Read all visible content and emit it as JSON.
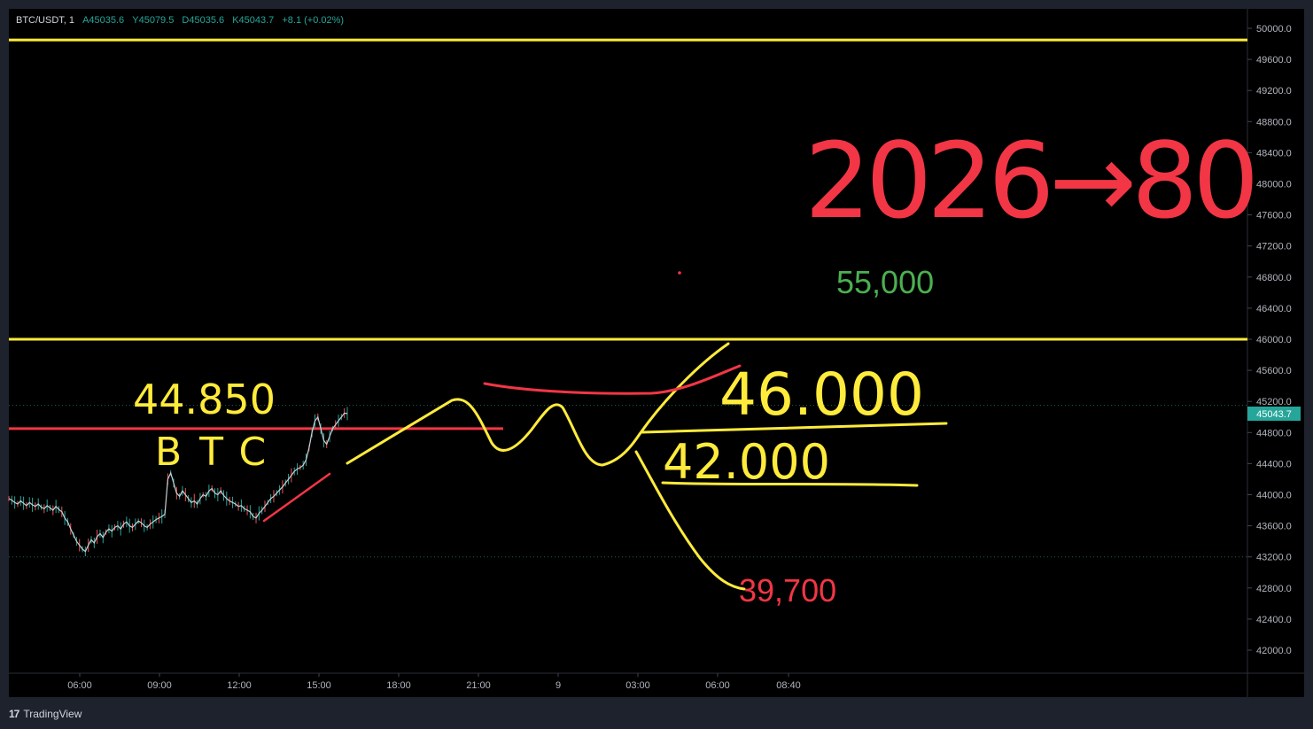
{
  "legend": {
    "symbol": "BTC/USDT, 1",
    "open": "A45035.6",
    "high": "Y45079.5",
    "low": "D45035.6",
    "close": "K45043.7",
    "change": "+8.1 (+0.02%)"
  },
  "branding": {
    "name": "TradingView"
  },
  "chart_data": {
    "type": "line",
    "title": "",
    "xlabel": "",
    "ylabel": "",
    "ylim": [
      41800,
      50200
    ],
    "y_ticks": [
      42000,
      42400,
      42800,
      43200,
      43600,
      44000,
      44400,
      44800,
      45200,
      45600,
      46000,
      46400,
      46800,
      47200,
      47600,
      48000,
      48400,
      48800,
      49200,
      49600,
      50000
    ],
    "y_tick_labels": [
      "42000.0",
      "42400.0",
      "42800.0",
      "43200.0",
      "43600.0",
      "44000.0",
      "44400.0",
      "44800.0",
      "45200.0",
      "45600.0",
      "46000.0",
      "46400.0",
      "46800.0",
      "47200.0",
      "47600.0",
      "48000.0",
      "48400.0",
      "48800.0",
      "49200.0",
      "49600.0",
      "50000.0"
    ],
    "x_tick_labels": [
      "06:00",
      "09:00",
      "12:00",
      "15:00",
      "18:00",
      "21:00",
      "9",
      "03:00",
      "06:00",
      "08:40"
    ],
    "current_price_label": "45043.7",
    "current_price": 45043.7,
    "series": [
      {
        "values": [
          43950,
          43930,
          43900,
          43880,
          43920,
          43890,
          43860,
          43900,
          43870,
          43850,
          43880,
          43840,
          43820,
          43860,
          43830,
          43800,
          43850,
          43810,
          43780,
          43700,
          43650,
          43560,
          43480,
          43400,
          43350,
          43300,
          43270,
          43350,
          43420,
          43380,
          43460,
          43500,
          43450,
          43520,
          43560,
          43530,
          43580,
          43600,
          43560,
          43620,
          43650,
          43600,
          43580,
          43620,
          43660,
          43640,
          43600,
          43580,
          43620,
          43650,
          43680,
          43700,
          43720,
          43750,
          44200,
          44280,
          44150,
          44020,
          43980,
          44050,
          44000,
          43950,
          43900,
          43920,
          43880,
          43950,
          44000,
          43980,
          44050,
          44080,
          44020,
          44000,
          44050,
          43990,
          43950,
          43920,
          43900,
          43880,
          43850,
          43860,
          43820,
          43800,
          43780,
          43720,
          43700,
          43760,
          43800,
          43850,
          43900,
          43950,
          43980,
          44020,
          44060,
          44100,
          44150,
          44200,
          44250,
          44300,
          44330,
          44350,
          44380,
          44450,
          44600,
          44800,
          44950,
          45000,
          44850,
          44700,
          44650,
          44750,
          44850,
          44900,
          44950,
          45000,
          45050,
          45043.7
        ]
      }
    ],
    "horizontal_levels": [
      {
        "value": 49850,
        "color": "#ffeb3b"
      },
      {
        "value": 46000,
        "color": "#ffeb3b"
      },
      {
        "value": 44850,
        "color": "#f23645"
      }
    ],
    "annotations": [
      {
        "text": "44.850",
        "color": "#ffeb3b"
      },
      {
        "text": "BTC",
        "color": "#ffeb3b"
      },
      {
        "text": "46.000",
        "color": "#ffeb3b"
      },
      {
        "text": "42.000",
        "color": "#ffeb3b"
      },
      {
        "text": "55,000",
        "color": "#4caf50"
      },
      {
        "text": "39,700",
        "color": "#f23645"
      },
      {
        "text": "2026→80",
        "color": "#f23645"
      }
    ],
    "colors": {
      "background": "#000000",
      "axis_text": "#b2b5be",
      "price_line": "#26a69a",
      "price_tag": "#26a69a",
      "highlight_yellow": "#ffeb3b",
      "highlight_red": "#f23645"
    }
  }
}
